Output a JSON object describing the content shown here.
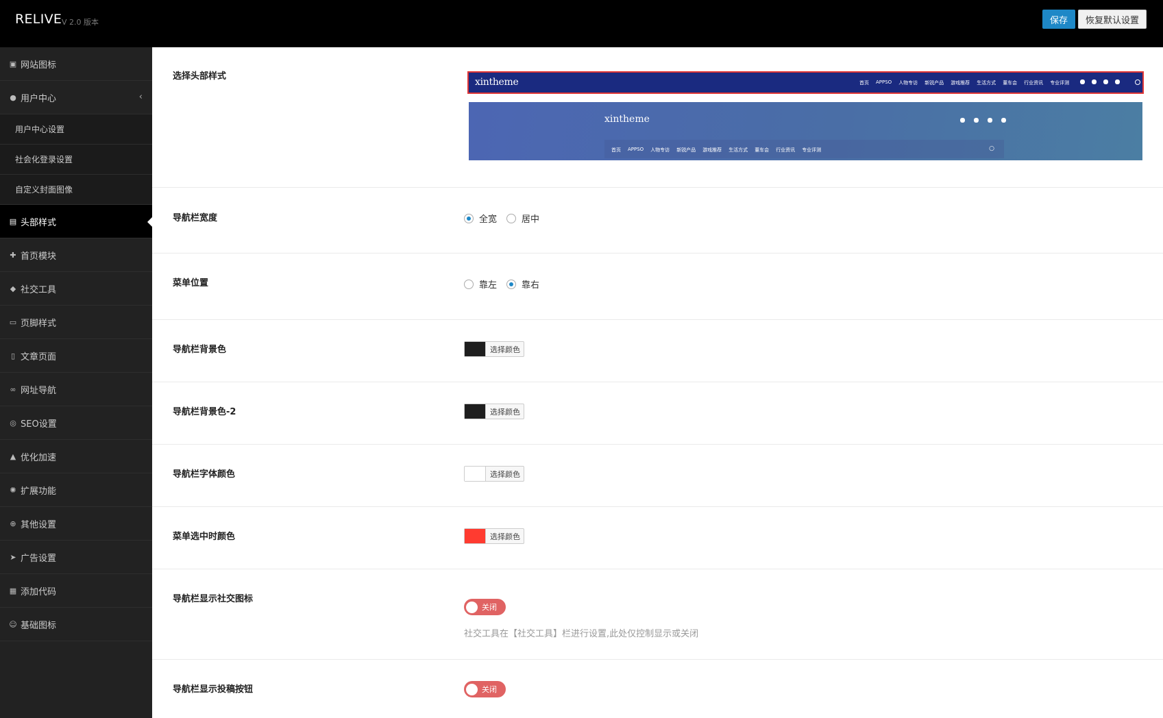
{
  "header": {
    "brand": "RELIVE",
    "version": "V 2.0 版本",
    "save_label": "保存",
    "reset_label": "恢复默认设置"
  },
  "sidebar": {
    "items": [
      {
        "label": "网站图标",
        "icon": "image-icon"
      },
      {
        "label": "用户中心",
        "icon": "user-icon",
        "expanded": true,
        "subitems": [
          "用户中心设置",
          "社会化登录设置",
          "自定义封面图像"
        ]
      },
      {
        "label": "头部样式",
        "icon": "window-icon",
        "active": true
      },
      {
        "label": "首页模块",
        "icon": "puzzle-icon"
      },
      {
        "label": "社交工具",
        "icon": "bell-icon"
      },
      {
        "label": "页脚样式",
        "icon": "footer-icon"
      },
      {
        "label": "文章页面",
        "icon": "document-icon"
      },
      {
        "label": "网址导航",
        "icon": "link-icon"
      },
      {
        "label": "SEO设置",
        "icon": "circle-icon"
      },
      {
        "label": "优化加速",
        "icon": "rocket-icon"
      },
      {
        "label": "扩展功能",
        "icon": "bulb-icon"
      },
      {
        "label": "其他设置",
        "icon": "plus-circle-icon"
      },
      {
        "label": "广告设置",
        "icon": "paper-plane-icon"
      },
      {
        "label": "添加代码",
        "icon": "code-icon"
      },
      {
        "label": "基础图标",
        "icon": "smile-icon"
      }
    ]
  },
  "settings": {
    "header_style": {
      "label": "选择头部样式",
      "preview1": {
        "logo": "xintheme",
        "menu": [
          "首页",
          "APPSO",
          "人物专访",
          "新锐产品",
          "游戏推荐",
          "生活方式",
          "董车会",
          "行业资讯",
          "专业评测"
        ]
      },
      "preview2": {
        "logo": "xintheme",
        "menu": [
          "首页",
          "APPSO",
          "人物专访",
          "新锐产品",
          "游戏推荐",
          "生活方式",
          "董车会",
          "行业资讯",
          "专业评测"
        ]
      }
    },
    "nav_width": {
      "label": "导航栏宽度",
      "options": [
        "全宽",
        "居中"
      ],
      "selected": 0
    },
    "menu_position": {
      "label": "菜单位置",
      "options": [
        "靠左",
        "靠右"
      ],
      "selected": 1
    },
    "nav_bg": {
      "label": "导航栏背景色",
      "button": "选择颜色",
      "color": "#1e1e1e"
    },
    "nav_bg2": {
      "label": "导航栏背景色-2",
      "button": "选择颜色",
      "color": "#1e1e1e"
    },
    "nav_font": {
      "label": "导航栏字体颜色",
      "button": "选择颜色",
      "color": "#ffffff"
    },
    "menu_active": {
      "label": "菜单选中时颜色",
      "button": "选择颜色",
      "color": "#ff3b30"
    },
    "nav_social": {
      "label": "导航栏显示社交图标",
      "toggle": "关闭",
      "hint": "社交工具在【社交工具】栏进行设置,此处仅控制显示或关闭"
    },
    "nav_submit": {
      "label": "导航栏显示投稿按钮",
      "toggle": "关闭"
    }
  }
}
